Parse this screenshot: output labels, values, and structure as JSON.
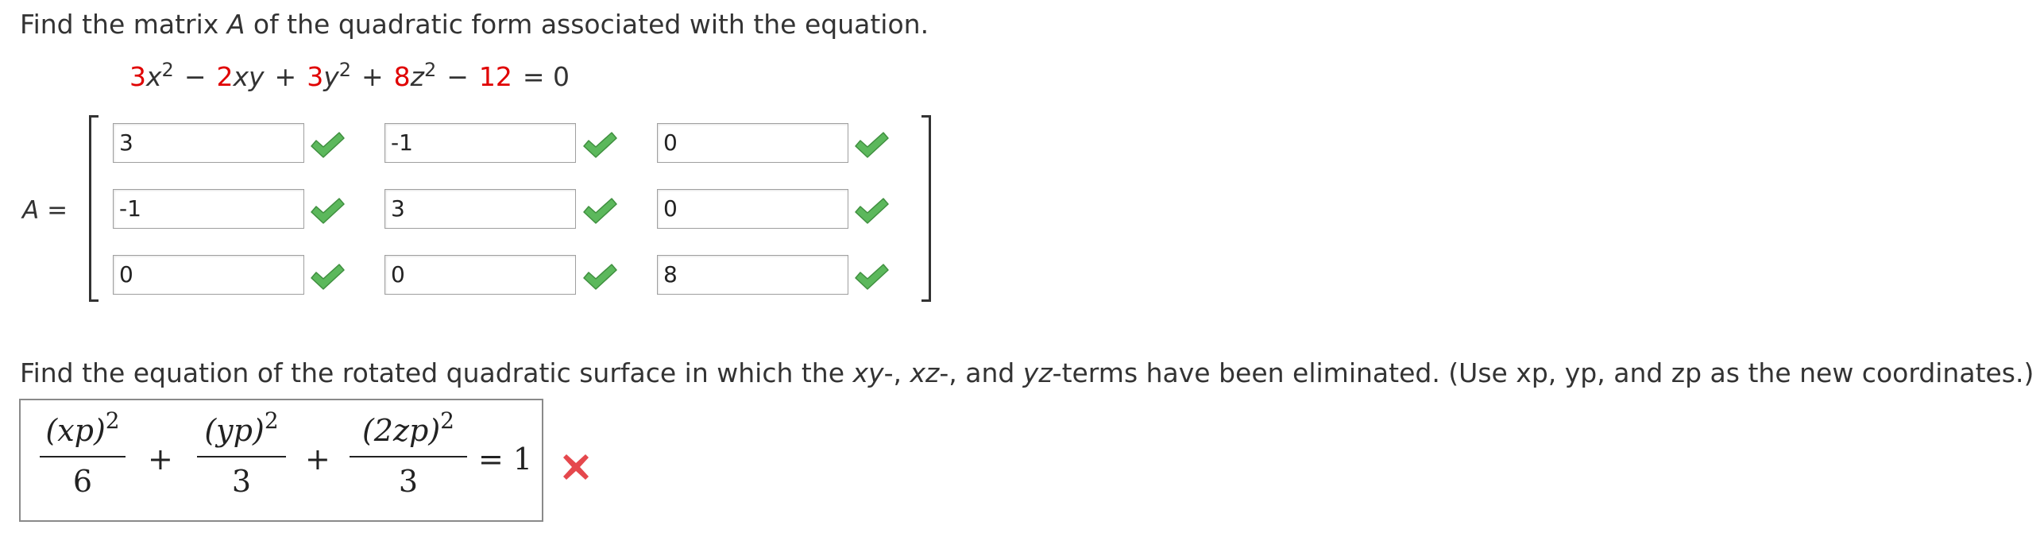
{
  "question1": {
    "prefix": "Find the matrix ",
    "matrix_var": "A",
    "suffix": " of the quadratic form associated with the equation."
  },
  "equation": {
    "c1": "3",
    "t1": "x",
    "e1": "2",
    "op1": "−",
    "c2": "2",
    "t2": "xy",
    "op2": "+",
    "c3": "3",
    "t3": "y",
    "e3": "2",
    "op3": "+",
    "c4": "8",
    "t4": "z",
    "e4": "2",
    "op4": "−",
    "c5": "12",
    "eq": "= 0"
  },
  "matrix": {
    "label_var": "A",
    "label_eq": " =",
    "rows": [
      [
        "3",
        "-1",
        "0"
      ],
      [
        "-1",
        "3",
        "0"
      ],
      [
        "0",
        "0",
        "8"
      ]
    ],
    "cell_status": "correct"
  },
  "question2": {
    "p1": "Find the equation of the rotated quadratic surface in which the ",
    "xy": "xy",
    "p2": "-, ",
    "xz": "xz",
    "p3": "-, and ",
    "yz": "yz",
    "p4": "-terms have been eliminated. (Use xp, yp, and zp as the new coordinates.)"
  },
  "answer": {
    "term1_num": "(xp)",
    "term1_exp": "2",
    "term1_den": "6",
    "plus1": "+",
    "term2_num": "(yp)",
    "term2_exp": "2",
    "term2_den": "3",
    "plus2": "+",
    "term3_num": "(2zp)",
    "term3_exp": "2",
    "term3_den": "3",
    "equals": "= 1",
    "status": "incorrect"
  },
  "icons": {
    "correct": "check-icon",
    "incorrect": "x-icon"
  },
  "colors": {
    "coefficient_red": "#e00000",
    "check_green": "#5cb85c",
    "x_red": "#e5484d",
    "text": "#333333"
  }
}
